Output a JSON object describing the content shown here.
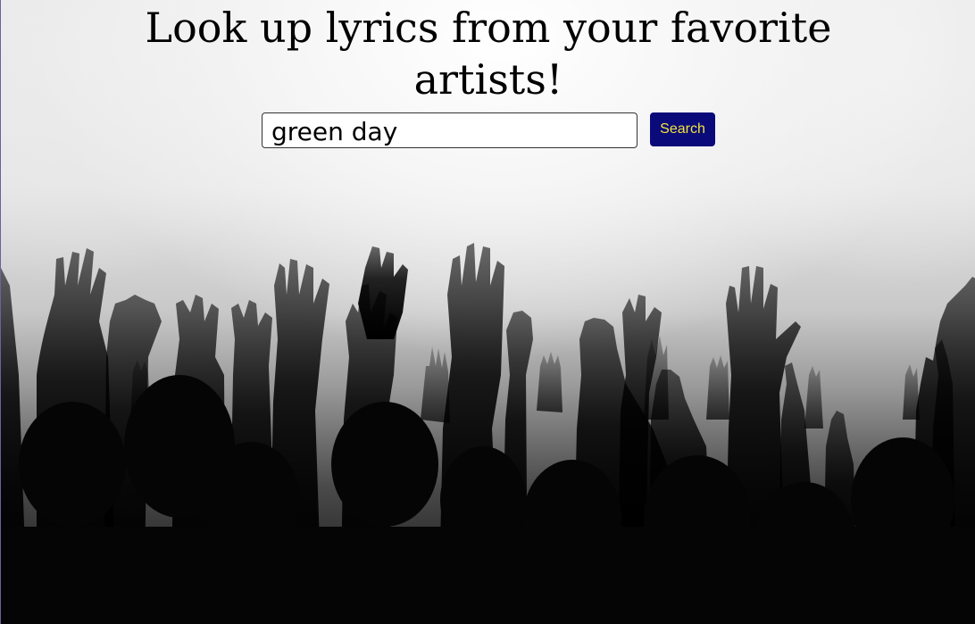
{
  "header": {
    "title": "Look up lyrics from your favorite artists!"
  },
  "search": {
    "value": "green day",
    "placeholder": "",
    "button_label": "Search"
  },
  "colors": {
    "button_background": "#0a0a7a",
    "button_text": "#f2e53a"
  },
  "background": {
    "image_subject": "concert-crowd-raised-hands"
  }
}
